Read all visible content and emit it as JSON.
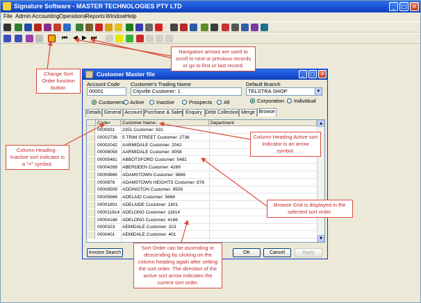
{
  "app": {
    "title": "Signature Software - MASTER TECHNOLOGIES PTY LTD",
    "window_buttons": {
      "minimize": "_",
      "maximize": "□",
      "close": "✕"
    }
  },
  "menubar": [
    "File",
    "Admin",
    "Accounting",
    "Operations",
    "Reports",
    "Window",
    "Help"
  ],
  "toolbar_nav": {
    "first": "⏮",
    "prev": "◀",
    "next": "▶",
    "last": "⏭"
  },
  "dialog": {
    "title": "Customer Master file",
    "account_code_label": "Account Code",
    "account_code_value": "00001",
    "trading_name_label": "Customer's Trading Name",
    "trading_name_value": "Cityville Customer: 1",
    "branch_label": "Default Branch",
    "branch_value": "TELSTRA SHOP",
    "filter_radios": [
      "Customers",
      "Active",
      "Inactive",
      "Prospects",
      "All"
    ],
    "type_radios": [
      "Corporation",
      "Individual"
    ],
    "tabs": [
      "Details",
      "General",
      "Account",
      "Purchase & Sales",
      "Enquiry",
      "Debt Collection",
      "Merge",
      "Browse"
    ],
    "grid_headers": {
      "code": "Code",
      "code_indicator": "=",
      "name": "Customer Name",
      "name_indicator": "↑",
      "department": "Department"
    },
    "rows": [
      {
        "code": "0000931",
        "name": "2351 Customer: 931"
      },
      {
        "code": "00002736",
        "name": "5 TRIM STREET  Customer: 2736"
      },
      {
        "code": "00002042",
        "name": "AARMIDALE Customer: 2042"
      },
      {
        "code": "00008058",
        "name": "AARMIDALE Customer: 8058"
      },
      {
        "code": "00005481",
        "name": "ABBOTSFORD Customer: 5481"
      },
      {
        "code": "00004269",
        "name": "ABERDEEN Customer: 4269"
      },
      {
        "code": "00009866",
        "name": "ADAMSTOWN Customer: 9866"
      },
      {
        "code": "0000876",
        "name": "ADAMSTOWN HEIGHTS Customer: 876"
      },
      {
        "code": "00008509",
        "name": "ADDINGTON Customer: 8509"
      },
      {
        "code": "00005666",
        "name": "ADELAID Customer: 5666"
      },
      {
        "code": "00001801",
        "name": "ADELAIDE Customer: 1801"
      },
      {
        "code": "000011814",
        "name": "ADELONG Customer: 11814"
      },
      {
        "code": "00004166",
        "name": "ADELONG Customer: 4166"
      },
      {
        "code": "0000323",
        "name": "AEMIDALE Customer: 323"
      },
      {
        "code": "0000401",
        "name": "AEMIDALE Customer: 401"
      }
    ],
    "buttons": {
      "invoice_search": "Invoice Search",
      "ok": "OK",
      "cancel": "Cancel",
      "apply": "Apply"
    }
  },
  "annotations": {
    "navigation": "Navigation arrows are used to scroll to next or previous records or go to first or last record.",
    "change_sort": "Change Sort Order function button",
    "inactive_sort": "Column Heading - Inactive sort indicator is a \"=\" symbol.",
    "active_sort": "Column Heading Active sort indicator is an arrow symbol.",
    "browse_grid": "Browse Grid is displayed in the selected sort order.",
    "sort_order": "Sort Order can be ascending or descending by clicking on the column heading again after setting the sort order.  The direction of the active sort arrow indicates the current sort order."
  },
  "colors": {
    "xp_blue": "#1a55d6",
    "annotation_red": "#d94a3a",
    "chrome": "#ece9d8"
  }
}
